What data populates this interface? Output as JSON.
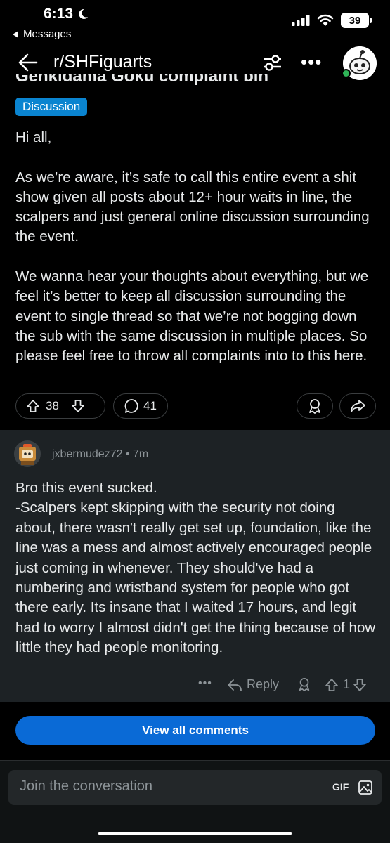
{
  "status_bar": {
    "time": "6:13",
    "back_label": "Messages",
    "battery": "39"
  },
  "nav": {
    "subreddit": "r/SHFiguarts"
  },
  "post": {
    "title_partial": "Genkidama Goku complaint bin",
    "flair": "Discussion",
    "body": "Hi all,\n\nAs we’re aware, it’s safe to call this entire event a shit show given all posts about 12+ hour waits in line, the scalpers and just general online discussion surrounding the event.\n\nWe wanna hear your thoughts about everything, but we feel it’s better to keep all discussion surrounding the event to single thread so that we’re not bogging down the sub with the same discussion in multiple places. So please feel free to throw all complaints into to this here.",
    "score": "38",
    "comment_count": "41"
  },
  "comment": {
    "username": "jxbermudez72",
    "time_ago": "7m",
    "body": "Bro this event sucked.\n-Scalpers kept skipping with the security not doing about, there wasn't really get set up, foundation, like the line was a mess and almost actively encouraged people just coming in whenever. They should've had a numbering and wristband system for people who got there early. Its insane that I waited 17 hours, and legit had to worry I almost didn't get the thing because of how little they had people monitoring.",
    "reply_label": "Reply",
    "score": "1"
  },
  "view_all_label": "View all comments",
  "composer": {
    "placeholder": "Join the conversation",
    "gif_label": "GIF"
  },
  "colors": {
    "accent_blue": "#0a6ad6",
    "flair_blue": "#0a84d0",
    "comment_bg": "#1d2225",
    "online_green": "#2fb457"
  },
  "icons": {
    "back": "arrow-left-icon",
    "filter": "filter-sliders-icon",
    "upvote": "arrow-up-icon",
    "downvote": "arrow-down-icon",
    "comments": "speech-bubble-icon",
    "award": "award-icon",
    "share": "share-icon",
    "image": "image-icon"
  }
}
